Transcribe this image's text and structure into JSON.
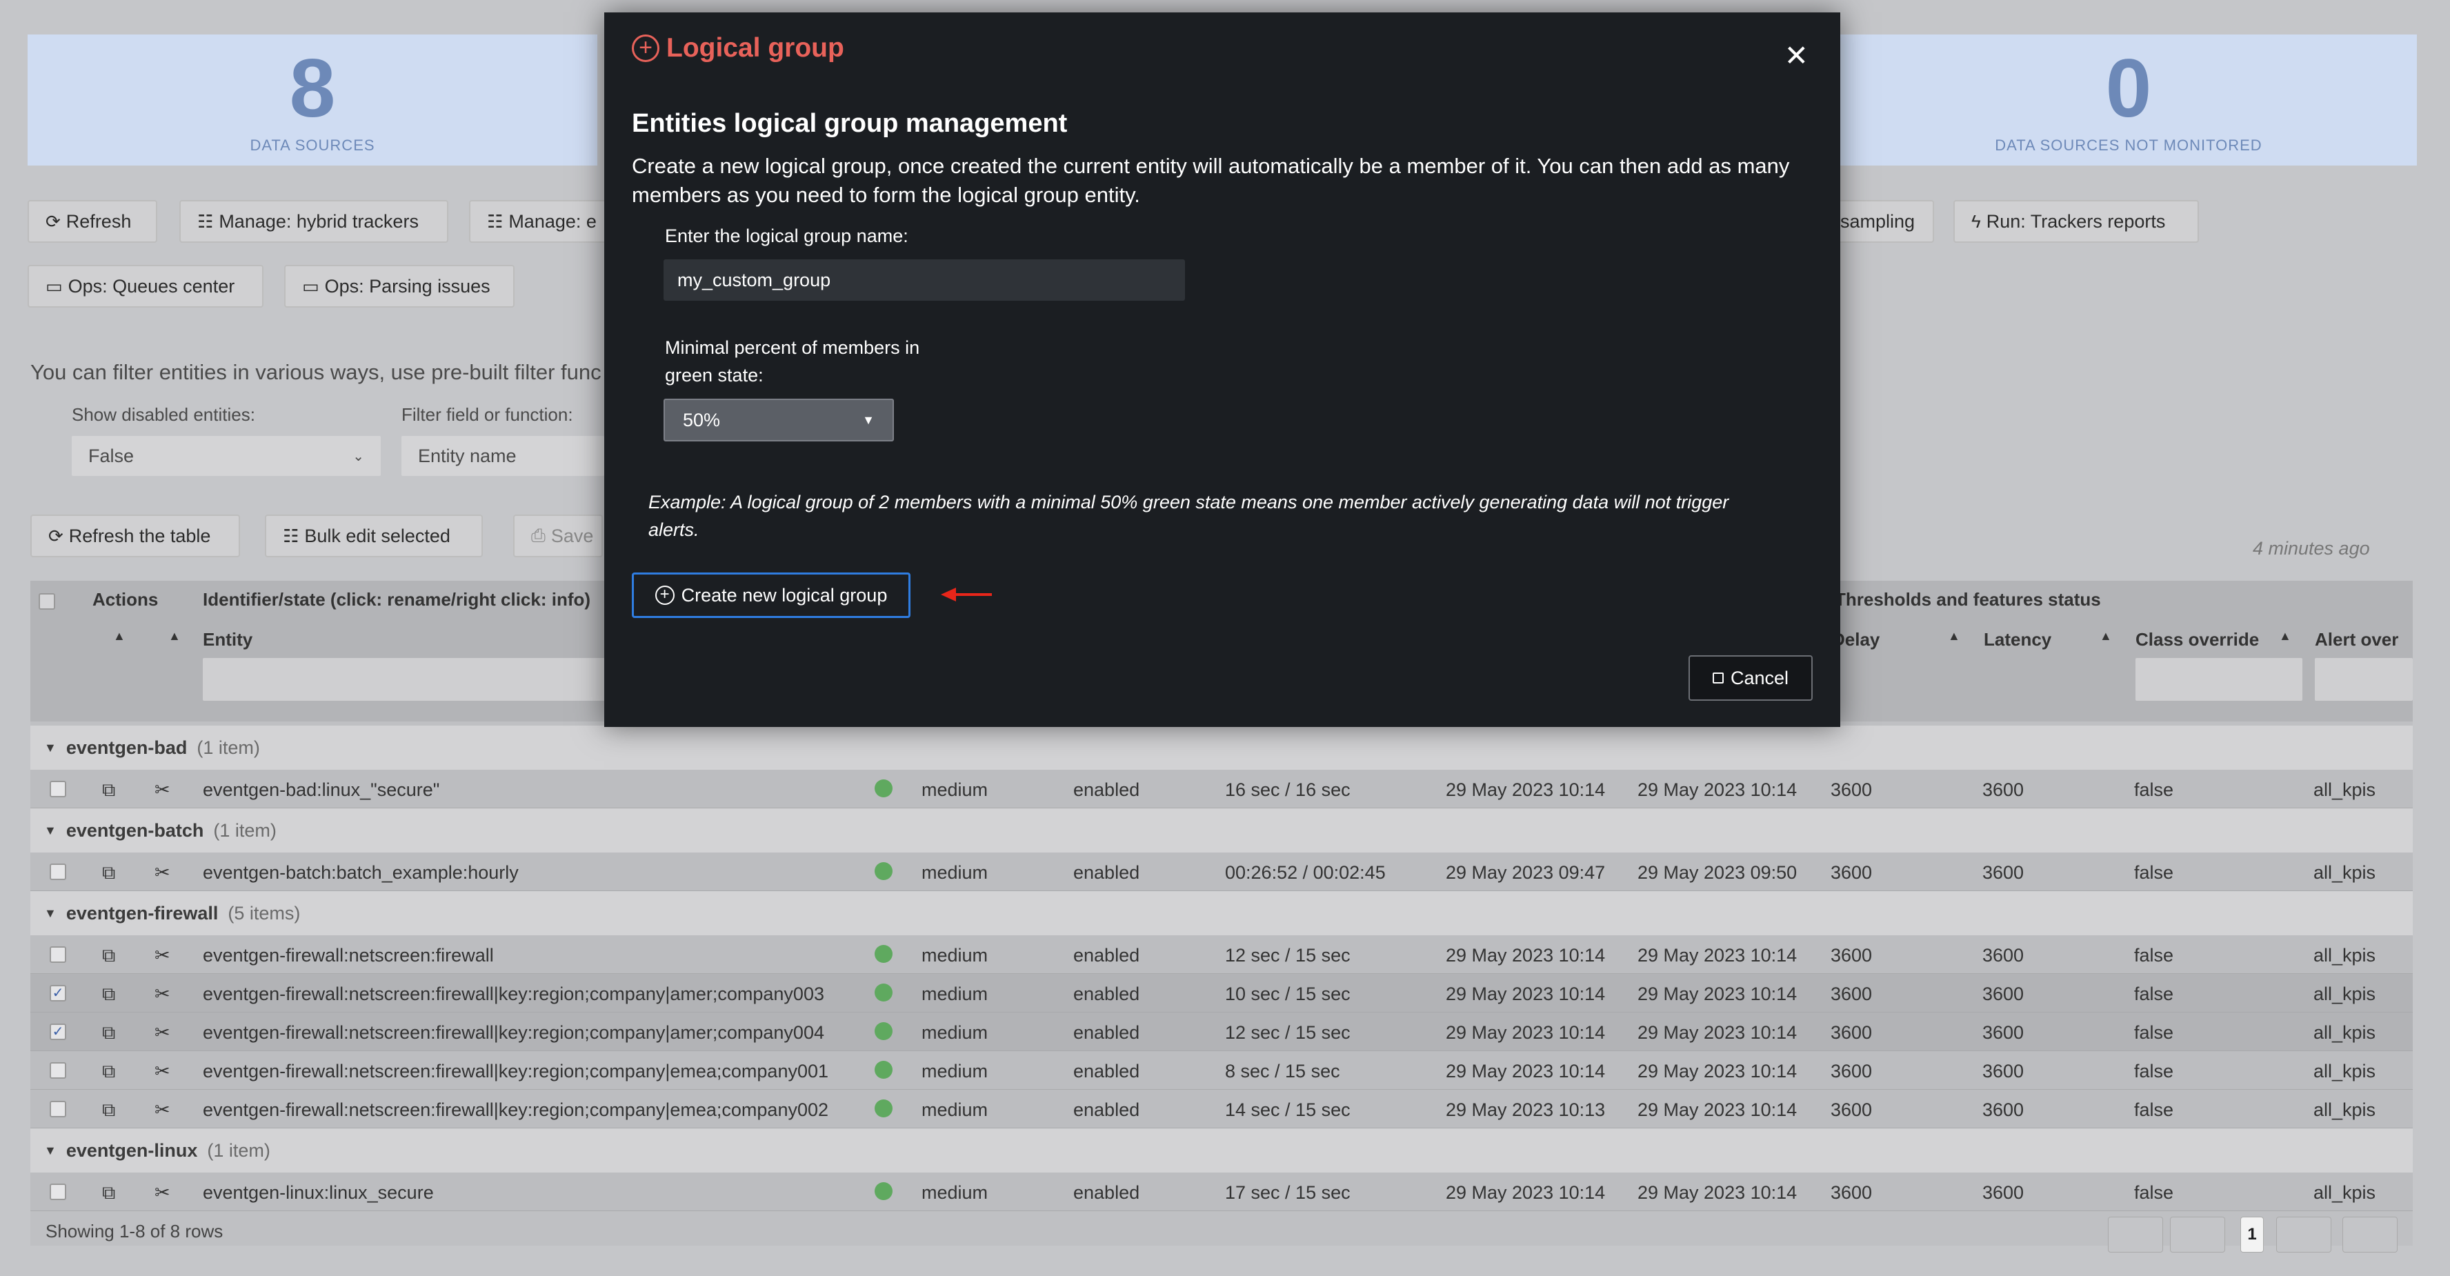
{
  "kpis": [
    {
      "value": "8",
      "label": "DATA SOURCES"
    },
    {
      "value": "0",
      "label": "DATA SOURCES NOT MONITORED"
    }
  ],
  "toolbar": {
    "row1": [
      "Refresh",
      "Manage: hybrid trackers",
      "Manage: e",
      "sampling",
      "Run: Trackers reports"
    ],
    "row2": [
      "Ops: Queues center",
      "Ops: Parsing issues"
    ]
  },
  "filter": {
    "intro": "You can filter entities in various ways, use pre-built filter func",
    "disabled_label": "Show disabled entities:",
    "disabled_value": "False",
    "field_label": "Filter field or function:",
    "field_value": "Entity name"
  },
  "table_actions": {
    "refresh": "Refresh the table",
    "bulk": "Bulk edit selected",
    "save": "Save",
    "updated": "4 minutes ago"
  },
  "table": {
    "headers": {
      "actions": "Actions",
      "identifier": "Identifier/state (click: rename/right click: info)",
      "thresholds": "Thresholds and features status",
      "entity": "Entity",
      "delay": "Delay",
      "latency": "Latency",
      "class_override": "Class override",
      "alert_over": "Alert over"
    },
    "groups": [
      {
        "name": "eventgen-bad",
        "count": "(1 item)",
        "rows": [
          {
            "checked": false,
            "entity": "eventgen-bad:linux_\"secure\"",
            "priority": "medium",
            "state": "enabled",
            "lag": "16 sec / 16 sec",
            "first": "29 May 2023 10:14",
            "last": "29 May 2023 10:14",
            "delay": "3600",
            "latency": "3600",
            "class_override": "false",
            "alert": "all_kpis"
          }
        ]
      },
      {
        "name": "eventgen-batch",
        "count": "(1 item)",
        "rows": [
          {
            "checked": false,
            "entity": "eventgen-batch:batch_example:hourly",
            "priority": "medium",
            "state": "enabled",
            "lag": "00:26:52 / 00:02:45",
            "first": "29 May 2023 09:47",
            "last": "29 May 2023 09:50",
            "delay": "3600",
            "latency": "3600",
            "class_override": "false",
            "alert": "all_kpis"
          }
        ]
      },
      {
        "name": "eventgen-firewall",
        "count": "(5 items)",
        "rows": [
          {
            "checked": false,
            "entity": "eventgen-firewall:netscreen:firewall",
            "priority": "medium",
            "state": "enabled",
            "lag": "12 sec / 15 sec",
            "first": "29 May 2023 10:14",
            "last": "29 May 2023 10:14",
            "delay": "3600",
            "latency": "3600",
            "class_override": "false",
            "alert": "all_kpis"
          },
          {
            "checked": true,
            "entity": "eventgen-firewall:netscreen:firewall|key:region;company|amer;company003",
            "priority": "medium",
            "state": "enabled",
            "lag": "10 sec / 15 sec",
            "first": "29 May 2023 10:14",
            "last": "29 May 2023 10:14",
            "delay": "3600",
            "latency": "3600",
            "class_override": "false",
            "alert": "all_kpis"
          },
          {
            "checked": true,
            "entity": "eventgen-firewall:netscreen:firewall|key:region;company|amer;company004",
            "priority": "medium",
            "state": "enabled",
            "lag": "12 sec / 15 sec",
            "first": "29 May 2023 10:14",
            "last": "29 May 2023 10:14",
            "delay": "3600",
            "latency": "3600",
            "class_override": "false",
            "alert": "all_kpis"
          },
          {
            "checked": false,
            "entity": "eventgen-firewall:netscreen:firewall|key:region;company|emea;company001",
            "priority": "medium",
            "state": "enabled",
            "lag": "8 sec / 15 sec",
            "first": "29 May 2023 10:14",
            "last": "29 May 2023 10:14",
            "delay": "3600",
            "latency": "3600",
            "class_override": "false",
            "alert": "all_kpis"
          },
          {
            "checked": false,
            "entity": "eventgen-firewall:netscreen:firewall|key:region;company|emea;company002",
            "priority": "medium",
            "state": "enabled",
            "lag": "14 sec / 15 sec",
            "first": "29 May 2023 10:13",
            "last": "29 May 2023 10:14",
            "delay": "3600",
            "latency": "3600",
            "class_override": "false",
            "alert": "all_kpis"
          }
        ]
      },
      {
        "name": "eventgen-linux",
        "count": "(1 item)",
        "rows": [
          {
            "checked": false,
            "entity": "eventgen-linux:linux_secure",
            "priority": "medium",
            "state": "enabled",
            "lag": "17 sec / 15 sec",
            "first": "29 May 2023 10:14",
            "last": "29 May 2023 10:14",
            "delay": "3600",
            "latency": "3600",
            "class_override": "false",
            "alert": "all_kpis"
          }
        ]
      }
    ],
    "footer": "Showing 1-8 of 8 rows",
    "page": "1"
  },
  "modal": {
    "title": "Logical group",
    "heading": "Entities logical group management",
    "description": "Create a new logical group, once created the current entity will automatically be a member of it. You can then add as many members as you need to form the logical group entity.",
    "name_label": "Enter the logical group name:",
    "name_value": "my_custom_group",
    "percent_label": "Minimal percent of members in green state:",
    "percent_value": "50%",
    "example": "Example: A logical group of 2 members with a minimal 50% green state means one member actively generating data will not trigger alerts.",
    "create_label": "Create new logical group",
    "cancel_label": "Cancel"
  },
  "colors": {
    "modal_bg": "#1b1e22",
    "title_accent": "#e8625a",
    "primary_border": "#2f7de1",
    "arrow": "#e8261a"
  }
}
